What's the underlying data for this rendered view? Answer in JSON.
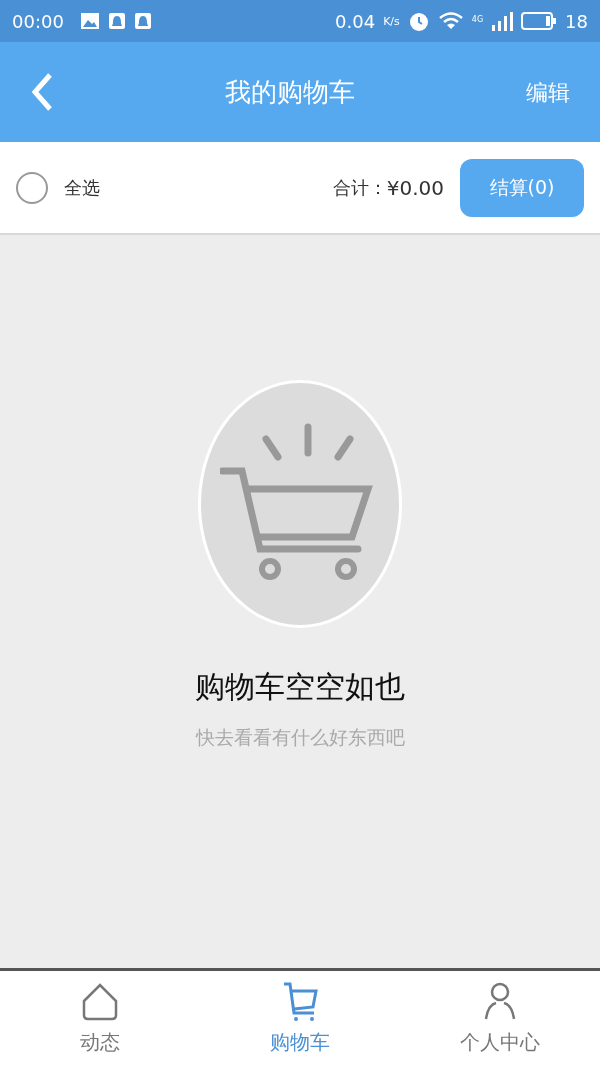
{
  "status_bar": {
    "time": "00:00",
    "speed": "0.04",
    "speed_unit": "K/s",
    "network": "4G",
    "battery": "18"
  },
  "header": {
    "title": "我的购物车",
    "action": "编辑"
  },
  "toolbar": {
    "select_all": {
      "label": "全选",
      "checked": false
    },
    "total_label": "合计：",
    "total": "¥0.00",
    "checkout": "结算(0)"
  },
  "empty_state": {
    "title": "购物车空空如也",
    "subtitle": "快去看看有什么好东西吧"
  },
  "tabs": [
    {
      "label": "动态",
      "kind": "home",
      "selected": false
    },
    {
      "label": "购物车",
      "kind": "cart",
      "selected": true
    },
    {
      "label": "个人中心",
      "kind": "person",
      "selected": false
    }
  ]
}
